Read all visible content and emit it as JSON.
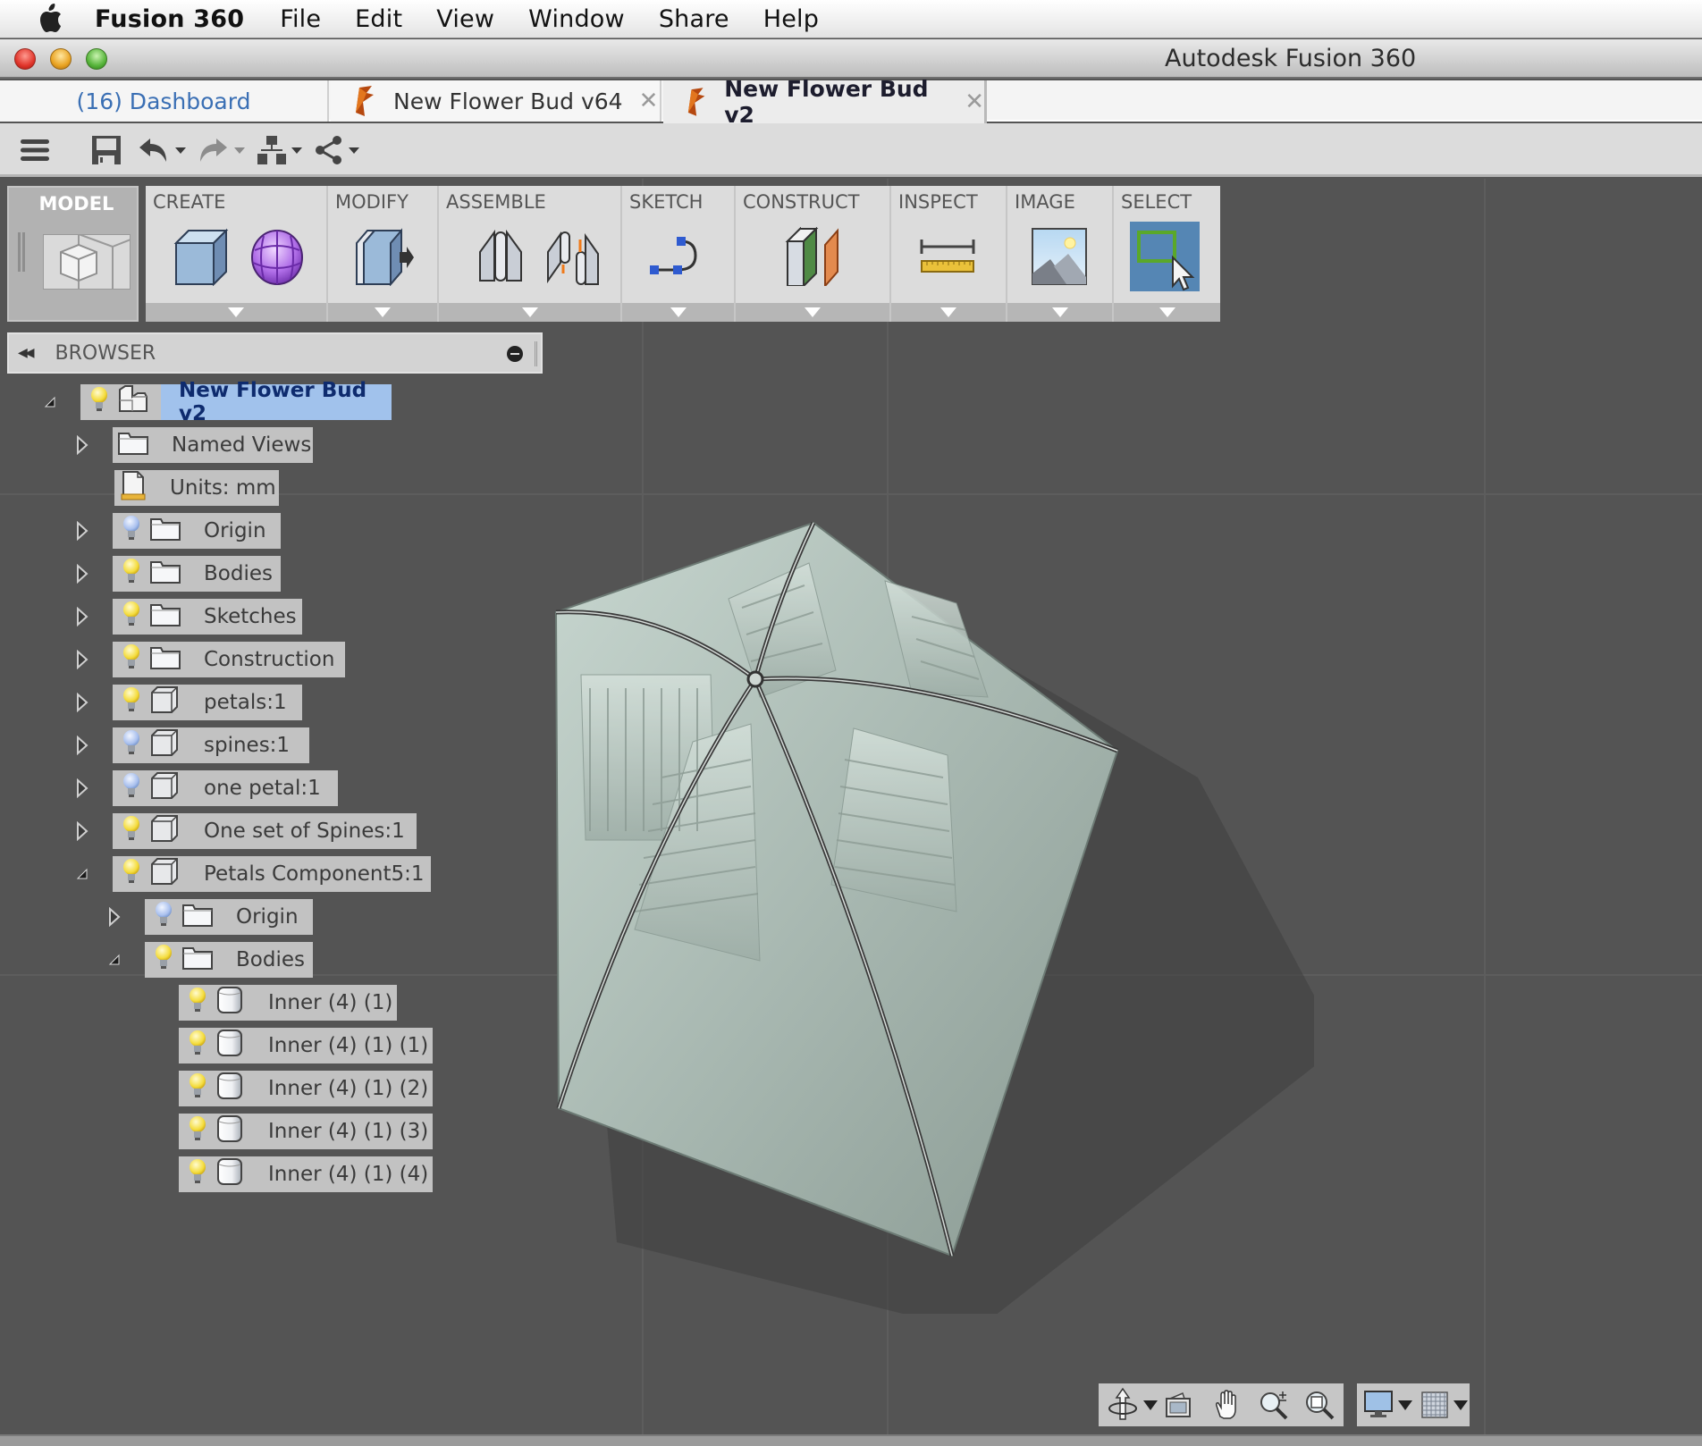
{
  "menubar": {
    "app_name": "Fusion 360",
    "items": [
      "File",
      "Edit",
      "View",
      "Window",
      "Share",
      "Help"
    ]
  },
  "window": {
    "title": "Autodesk Fusion 360"
  },
  "tabs": [
    {
      "label": "(16) Dashboard",
      "active": false,
      "closable": false
    },
    {
      "label": "New Flower Bud v64",
      "active": false,
      "closable": true
    },
    {
      "label": "New Flower Bud v2",
      "active": true,
      "closable": true
    }
  ],
  "quick_toolbar": {
    "icons": [
      "menu-icon",
      "save-icon",
      "undo-icon",
      "redo-icon",
      "assembly-tree-icon",
      "share-icon"
    ]
  },
  "ribbon": {
    "workspace": "MODEL",
    "panels": [
      {
        "label": "CREATE",
        "icons": [
          "box-icon",
          "sphere-icon"
        ]
      },
      {
        "label": "MODIFY",
        "icons": [
          "press-pull-icon"
        ]
      },
      {
        "label": "ASSEMBLE",
        "icons": [
          "joint-icon",
          "as-built-joint-icon"
        ]
      },
      {
        "label": "SKETCH",
        "icons": [
          "sketch-curve-icon"
        ]
      },
      {
        "label": "CONSTRUCT",
        "icons": [
          "plane-icon"
        ]
      },
      {
        "label": "INSPECT",
        "icons": [
          "measure-icon"
        ]
      },
      {
        "label": "IMAGE",
        "icons": [
          "render-image-icon"
        ]
      },
      {
        "label": "SELECT",
        "icons": [
          "select-window-icon"
        ]
      }
    ]
  },
  "browser": {
    "title": "BROWSER",
    "tree": [
      {
        "label": "New Flower Bud v2",
        "type": "root",
        "bulb": "on",
        "expanded": true,
        "selected": true
      },
      {
        "label": "Named Views",
        "type": "folder",
        "bulb": null,
        "expanded": false
      },
      {
        "label": "Units: mm",
        "type": "units",
        "bulb": null,
        "expanded": null
      },
      {
        "label": "Origin",
        "type": "folder",
        "bulb": "off",
        "expanded": false
      },
      {
        "label": "Bodies",
        "type": "folder",
        "bulb": "on",
        "expanded": false
      },
      {
        "label": "Sketches",
        "type": "folder",
        "bulb": "on",
        "expanded": false
      },
      {
        "label": "Construction",
        "type": "folder",
        "bulb": "on",
        "expanded": false
      },
      {
        "label": "petals:1",
        "type": "component",
        "bulb": "on",
        "expanded": false
      },
      {
        "label": "spines:1",
        "type": "component",
        "bulb": "off",
        "expanded": false
      },
      {
        "label": "one petal:1",
        "type": "component",
        "bulb": "off",
        "expanded": false
      },
      {
        "label": "One set of Spines:1",
        "type": "component",
        "bulb": "on",
        "expanded": false
      },
      {
        "label": "Petals Component5:1",
        "type": "component",
        "bulb": "on",
        "expanded": true
      },
      {
        "label": "Origin",
        "type": "folder",
        "bulb": "off",
        "expanded": false
      },
      {
        "label": "Bodies",
        "type": "folder",
        "bulb": "on",
        "expanded": true
      },
      {
        "label": "Inner (4) (1)",
        "type": "body",
        "bulb": "on",
        "expanded": null
      },
      {
        "label": "Inner (4) (1) (1)",
        "type": "body",
        "bulb": "on",
        "expanded": null
      },
      {
        "label": "Inner (4) (1) (2)",
        "type": "body",
        "bulb": "on",
        "expanded": null
      },
      {
        "label": "Inner (4) (1) (3)",
        "type": "body",
        "bulb": "on",
        "expanded": null
      },
      {
        "label": "Inner (4) (1) (4)",
        "type": "body",
        "bulb": "on",
        "expanded": null
      }
    ]
  },
  "navbar": {
    "icons": [
      "orbit-icon",
      "look-at-icon",
      "pan-icon",
      "zoom-icon",
      "fit-icon",
      "display-settings-icon",
      "grid-settings-icon"
    ]
  },
  "colors": {
    "accent_selected": "#a1c2ec",
    "select_panel": "#5586b4",
    "dashboard_link": "#3a6fb4",
    "bulb_on": "#f4dc3c",
    "bulb_off": "#b8cdf0",
    "model_body": "#b7c6bf"
  }
}
